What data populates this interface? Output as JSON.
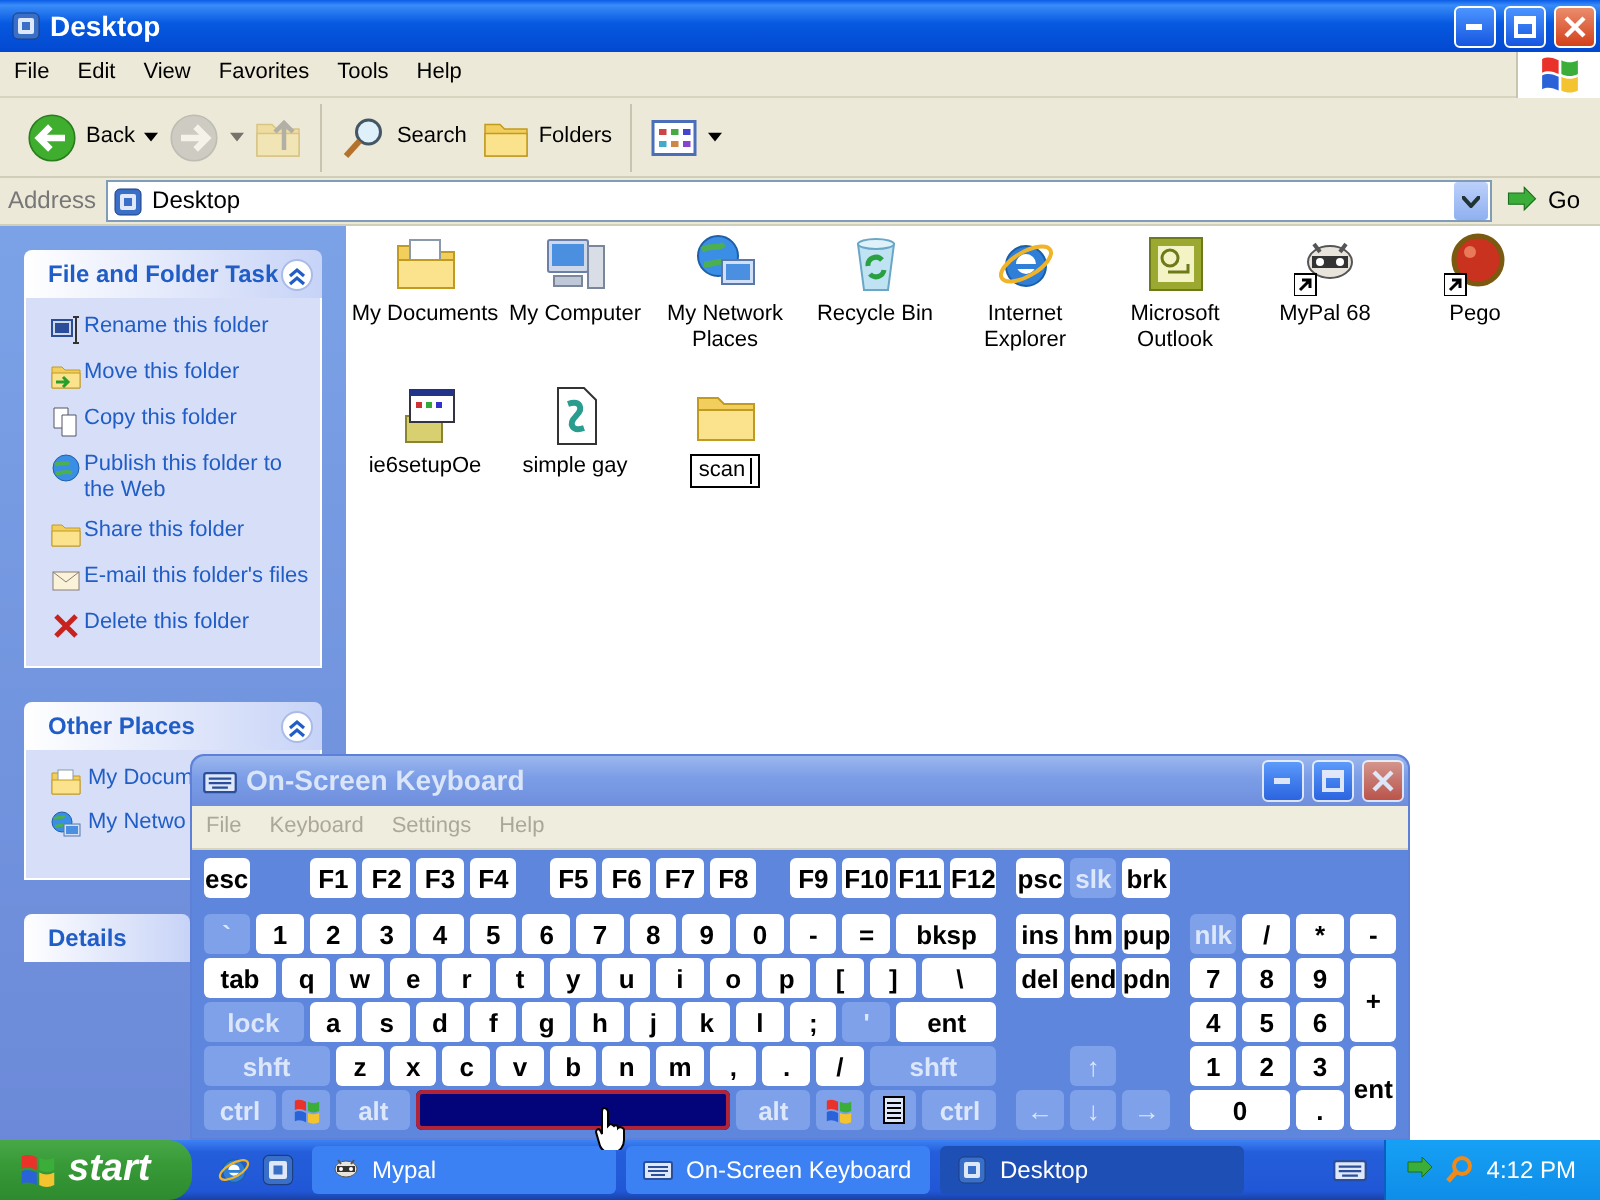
{
  "window": {
    "title": "Desktop",
    "active": true
  },
  "menu": [
    "File",
    "Edit",
    "View",
    "Favorites",
    "Tools",
    "Help"
  ],
  "toolbar": [
    [
      {
        "kind": "back",
        "label": "Back",
        "dropdown": true,
        "disabled": false
      },
      {
        "kind": "forward",
        "dropdown": true,
        "disabled": true
      },
      {
        "kind": "up",
        "disabled": true
      }
    ],
    [
      {
        "kind": "search",
        "label": "Search",
        "disabled": false
      },
      {
        "kind": "folders",
        "label": "Folders",
        "disabled": false
      }
    ],
    [
      {
        "kind": "views",
        "dropdown": true,
        "disabled": false
      }
    ]
  ],
  "address": {
    "label": "Address",
    "value": "Desktop",
    "go": "Go"
  },
  "task_panels": [
    {
      "title": "File and Folder Task",
      "expanded": true,
      "items": [
        {
          "kind": "rename",
          "label": "Rename this folder"
        },
        {
          "kind": "move",
          "label": "Move this folder"
        },
        {
          "kind": "copy",
          "label": "Copy this folder"
        },
        {
          "kind": "publish",
          "label": "Publish this folder to the Web"
        },
        {
          "kind": "share",
          "label": "Share this folder"
        },
        {
          "kind": "email",
          "label": "E-mail this folder's files"
        },
        {
          "kind": "delete",
          "label": "Delete this folder"
        }
      ]
    },
    {
      "title": "Other Places",
      "expanded": true,
      "items": [
        {
          "kind": "documents",
          "label": "My Docum"
        },
        {
          "kind": "network",
          "label": "My Netwo"
        }
      ]
    },
    {
      "title": "Details"
    }
  ],
  "desktop_icons": [
    {
      "label": "My Documents",
      "kind": "documents",
      "shortcut": false,
      "renaming": false
    },
    {
      "label": "My Computer",
      "kind": "computer",
      "shortcut": false,
      "renaming": false
    },
    {
      "label": "My Network Places",
      "kind": "network",
      "shortcut": false,
      "renaming": false
    },
    {
      "label": "Recycle Bin",
      "kind": "recycle",
      "shortcut": false,
      "renaming": false
    },
    {
      "label": "Internet Explorer",
      "kind": "browser",
      "shortcut": false,
      "renaming": false
    },
    {
      "label": "Microsoft Outlook",
      "kind": "mail",
      "shortcut": false,
      "renaming": false
    },
    {
      "label": "MyPal 68",
      "kind": "raccoon",
      "shortcut": true,
      "renaming": false
    },
    {
      "label": "Pego",
      "kind": "ball",
      "shortcut": true,
      "renaming": false
    },
    {
      "label": "ie6setupOe",
      "kind": "installer",
      "shortcut": false,
      "renaming": false
    },
    {
      "label": "simple gay",
      "kind": "document",
      "shortcut": false,
      "renaming": false
    },
    {
      "label": "scan",
      "kind": "folder",
      "shortcut": false,
      "renaming": true
    }
  ],
  "osk": {
    "title": "On-Screen Keyboard",
    "active": false,
    "menu": [
      "File",
      "Keyboard",
      "Settings",
      "Help"
    ],
    "key_rows": [
      {
        "keys": [
          {
            "label": "esc",
            "kind": "key",
            "pressed": false
          },
          {
            "label": "F1",
            "kind": "key",
            "pressed": false
          },
          {
            "label": "F2",
            "kind": "key",
            "pressed": false
          },
          {
            "label": "F3",
            "kind": "key",
            "pressed": false
          },
          {
            "label": "F4",
            "kind": "key",
            "pressed": false
          },
          {
            "label": "F5",
            "kind": "key",
            "pressed": false
          },
          {
            "label": "F6",
            "kind": "key",
            "pressed": false
          },
          {
            "label": "F7",
            "kind": "key",
            "pressed": false
          },
          {
            "label": "F8",
            "kind": "key",
            "pressed": false
          },
          {
            "label": "F9",
            "kind": "key",
            "pressed": false
          },
          {
            "label": "F10",
            "kind": "key",
            "pressed": false
          },
          {
            "label": "F11",
            "kind": "key",
            "pressed": false
          },
          {
            "label": "F12",
            "kind": "key",
            "pressed": false
          },
          {
            "label": "psc",
            "kind": "key",
            "pressed": false
          },
          {
            "label": "slk",
            "kind": "mod",
            "pressed": false
          },
          {
            "label": "brk",
            "kind": "key",
            "pressed": false
          }
        ]
      },
      {
        "keys": [
          {
            "label": "`",
            "kind": "mod",
            "pressed": false
          },
          {
            "label": "1",
            "kind": "key",
            "pressed": false
          },
          {
            "label": "2",
            "kind": "key",
            "pressed": false
          },
          {
            "label": "3",
            "kind": "key",
            "pressed": false
          },
          {
            "label": "4",
            "kind": "key",
            "pressed": false
          },
          {
            "label": "5",
            "kind": "key",
            "pressed": false
          },
          {
            "label": "6",
            "kind": "key",
            "pressed": false
          },
          {
            "label": "7",
            "kind": "key",
            "pressed": false
          },
          {
            "label": "8",
            "kind": "key",
            "pressed": false
          },
          {
            "label": "9",
            "kind": "key",
            "pressed": false
          },
          {
            "label": "0",
            "kind": "key",
            "pressed": false
          },
          {
            "label": "-",
            "kind": "key",
            "pressed": false
          },
          {
            "label": "=",
            "kind": "key",
            "pressed": false
          },
          {
            "label": "bksp",
            "kind": "key",
            "pressed": false
          },
          {
            "label": "ins",
            "kind": "key",
            "pressed": false
          },
          {
            "label": "hm",
            "kind": "key",
            "pressed": false
          },
          {
            "label": "pup",
            "kind": "key",
            "pressed": false
          },
          {
            "label": "nlk",
            "kind": "mod",
            "pressed": false
          },
          {
            "label": "/",
            "kind": "key",
            "pressed": false
          },
          {
            "label": "*",
            "kind": "key",
            "pressed": false
          },
          {
            "label": "-",
            "kind": "key",
            "pressed": false
          }
        ]
      },
      {
        "keys": [
          {
            "label": "tab",
            "kind": "key",
            "pressed": false
          },
          {
            "label": "q",
            "kind": "key",
            "pressed": false
          },
          {
            "label": "w",
            "kind": "key",
            "pressed": false
          },
          {
            "label": "e",
            "kind": "key",
            "pressed": false
          },
          {
            "label": "r",
            "kind": "key",
            "pressed": false
          },
          {
            "label": "t",
            "kind": "key",
            "pressed": false
          },
          {
            "label": "y",
            "kind": "key",
            "pressed": false
          },
          {
            "label": "u",
            "kind": "key",
            "pressed": false
          },
          {
            "label": "i",
            "kind": "key",
            "pressed": false
          },
          {
            "label": "o",
            "kind": "key",
            "pressed": false
          },
          {
            "label": "p",
            "kind": "key",
            "pressed": false
          },
          {
            "label": "[",
            "kind": "key",
            "pressed": false
          },
          {
            "label": "]",
            "kind": "key",
            "pressed": false
          },
          {
            "label": "\\",
            "kind": "key",
            "pressed": false
          },
          {
            "label": "del",
            "kind": "key",
            "pressed": false
          },
          {
            "label": "end",
            "kind": "key",
            "pressed": false
          },
          {
            "label": "pdn",
            "kind": "key",
            "pressed": false
          },
          {
            "label": "7",
            "kind": "key",
            "pressed": false
          },
          {
            "label": "8",
            "kind": "key",
            "pressed": false
          },
          {
            "label": "9",
            "kind": "key",
            "pressed": false
          },
          {
            "label": "+",
            "kind": "key",
            "pressed": false
          }
        ]
      },
      {
        "keys": [
          {
            "label": "lock",
            "kind": "mod",
            "pressed": false
          },
          {
            "label": "a",
            "kind": "key",
            "pressed": false
          },
          {
            "label": "s",
            "kind": "key",
            "pressed": false
          },
          {
            "label": "d",
            "kind": "key",
            "pressed": false
          },
          {
            "label": "f",
            "kind": "key",
            "pressed": false
          },
          {
            "label": "g",
            "kind": "key",
            "pressed": false
          },
          {
            "label": "h",
            "kind": "key",
            "pressed": false
          },
          {
            "label": "j",
            "kind": "key",
            "pressed": false
          },
          {
            "label": "k",
            "kind": "key",
            "pressed": false
          },
          {
            "label": "l",
            "kind": "key",
            "pressed": false
          },
          {
            "label": ";",
            "kind": "key",
            "pressed": false
          },
          {
            "label": "'",
            "kind": "mod",
            "pressed": false
          },
          {
            "label": "ent",
            "kind": "key",
            "pressed": false
          },
          {
            "label": "4",
            "kind": "key",
            "pressed": false
          },
          {
            "label": "5",
            "kind": "key",
            "pressed": false
          },
          {
            "label": "6",
            "kind": "key",
            "pressed": false
          }
        ]
      },
      {
        "keys": [
          {
            "label": "shft",
            "kind": "mod",
            "pressed": false
          },
          {
            "label": "z",
            "kind": "key",
            "pressed": false
          },
          {
            "label": "x",
            "kind": "key",
            "pressed": false
          },
          {
            "label": "c",
            "kind": "key",
            "pressed": false
          },
          {
            "label": "v",
            "kind": "key",
            "pressed": false
          },
          {
            "label": "b",
            "kind": "key",
            "pressed": false
          },
          {
            "label": "n",
            "kind": "key",
            "pressed": false
          },
          {
            "label": "m",
            "kind": "key",
            "pressed": false
          },
          {
            "label": ",",
            "kind": "key",
            "pressed": false
          },
          {
            "label": ".",
            "kind": "key",
            "pressed": false
          },
          {
            "label": "/",
            "kind": "key",
            "pressed": false
          },
          {
            "label": "shft",
            "kind": "mod",
            "pressed": false
          },
          {
            "label": "↑",
            "kind": "mod",
            "pressed": false
          },
          {
            "label": "1",
            "kind": "key",
            "pressed": false
          },
          {
            "label": "2",
            "kind": "key",
            "pressed": false
          },
          {
            "label": "3",
            "kind": "key",
            "pressed": false
          },
          {
            "label": "ent",
            "kind": "key",
            "pressed": false
          }
        ]
      },
      {
        "keys": [
          {
            "label": "ctrl",
            "kind": "mod",
            "pressed": false
          },
          {
            "kind": "win",
            "pressed": false
          },
          {
            "label": "alt",
            "kind": "mod",
            "pressed": false
          },
          {
            "kind": "space",
            "pressed": true
          },
          {
            "label": "alt",
            "kind": "mod",
            "pressed": false
          },
          {
            "kind": "win",
            "pressed": false
          },
          {
            "kind": "menu",
            "pressed": false
          },
          {
            "label": "ctrl",
            "kind": "mod",
            "pressed": false
          },
          {
            "label": "←",
            "kind": "mod",
            "pressed": false
          },
          {
            "label": "↓",
            "kind": "mod",
            "pressed": false
          },
          {
            "label": "→",
            "kind": "mod",
            "pressed": false
          },
          {
            "label": "0",
            "kind": "key",
            "pressed": false
          },
          {
            "label": ".",
            "kind": "key",
            "pressed": false
          }
        ]
      }
    ]
  },
  "taskbar": {
    "start": "start",
    "quick_launch": [
      {
        "kind": "browser"
      },
      {
        "kind": "desktop"
      }
    ],
    "tasks": [
      {
        "label": "Mypal",
        "kind": "raccoon",
        "selected": false
      },
      {
        "label": "On-Screen Keyboard",
        "kind": "keyboard",
        "selected": false
      },
      {
        "label": "Desktop",
        "kind": "desktop",
        "selected": true
      }
    ],
    "time": "4:12 PM"
  }
}
